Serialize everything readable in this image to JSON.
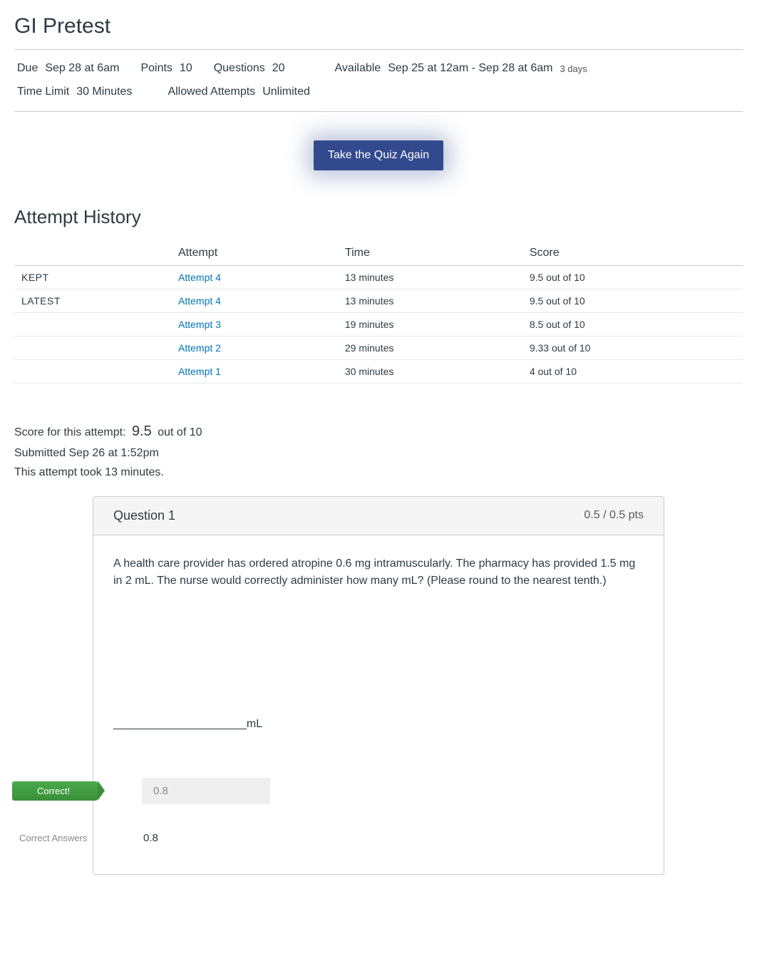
{
  "page_title": "GI Pretest",
  "details": {
    "due": {
      "label": "Due",
      "value": "Sep 28 at 6am"
    },
    "points": {
      "label": "Points",
      "value": "10"
    },
    "questions": {
      "label": "Questions",
      "value": "20"
    },
    "available": {
      "label": "Available",
      "value": "Sep 25 at 12am - Sep 28 at 6am",
      "days": "3 days"
    },
    "time_limit": {
      "label": "Time Limit",
      "value": "30 Minutes"
    },
    "allowed_attempts": {
      "label": "Allowed Attempts",
      "value": "Unlimited"
    }
  },
  "take_again_label": "Take the Quiz Again",
  "attempt_history_title": "Attempt History",
  "attempt_table": {
    "headers": {
      "status": "",
      "attempt": "Attempt",
      "time": "Time",
      "score": "Score"
    },
    "rows": [
      {
        "status": "KEPT",
        "attempt": "Attempt 4",
        "time": "13 minutes",
        "score": "9.5 out of 10"
      },
      {
        "status": "LATEST",
        "attempt": "Attempt 4",
        "time": "13 minutes",
        "score": "9.5 out of 10"
      },
      {
        "status": "",
        "attempt": "Attempt 3",
        "time": "19 minutes",
        "score": "8.5 out of 10"
      },
      {
        "status": "",
        "attempt": "Attempt 2",
        "time": "29 minutes",
        "score": "9.33 out of 10"
      },
      {
        "status": "",
        "attempt": "Attempt 1",
        "time": "30 minutes",
        "score": "4 out of 10"
      }
    ]
  },
  "score_summary": {
    "prefix": "Score for this attempt:",
    "score": "9.5",
    "suffix": "out of 10",
    "submitted": "Submitted Sep 26 at 1:52pm",
    "duration": "This attempt took 13 minutes."
  },
  "question1": {
    "title": "Question 1",
    "pts": "0.5 / 0.5 pts",
    "text": "A health care provider has ordered atropine 0.6 mg intramuscularly. The pharmacy has provided 1.5 mg in 2 mL. The nurse would correctly administer how many mL? (Please round to the nearest tenth.)",
    "blank_line": "_____________________mL",
    "correct_badge": "Correct!",
    "given_answer": "0.8",
    "correct_answers_label": "Correct Answers",
    "correct_answer_value": "0.8"
  }
}
